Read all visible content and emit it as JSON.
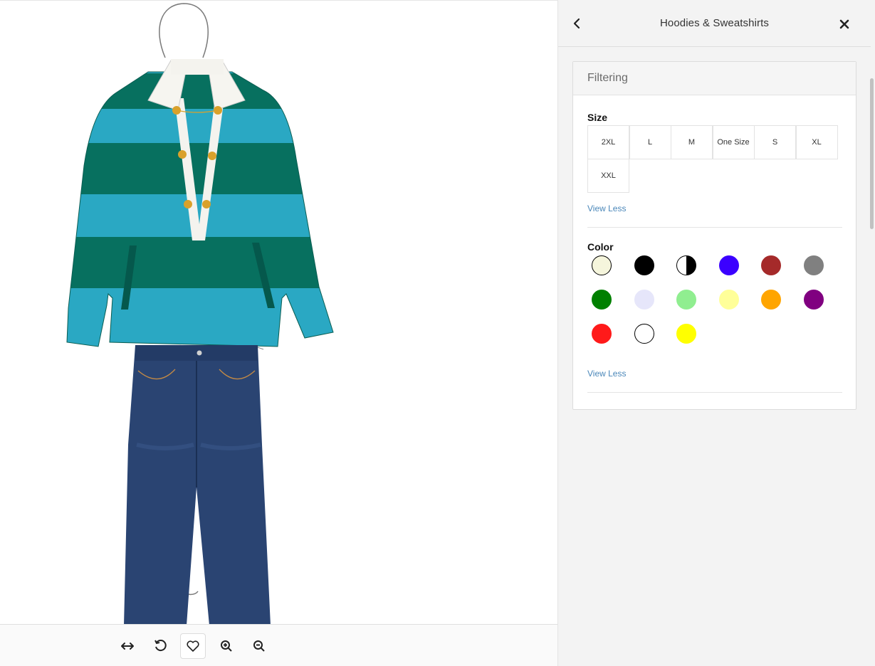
{
  "toolbar": {
    "items": [
      {
        "name": "fit-width-icon"
      },
      {
        "name": "undo-icon"
      },
      {
        "name": "heart-icon"
      },
      {
        "name": "zoom-in-icon"
      },
      {
        "name": "zoom-out-icon"
      }
    ]
  },
  "panel": {
    "title": "Hoodies & Sweatshirts",
    "filter_heading": "Filtering",
    "size": {
      "title": "Size",
      "options": [
        "2XL",
        "L",
        "M",
        "One Size",
        "S",
        "XL",
        "XXL"
      ],
      "view_less": "View Less"
    },
    "color": {
      "title": "Color",
      "swatches": [
        "#f5f5dc",
        "#000000",
        "black-white-half",
        "#3b00ff",
        "#a52a2a",
        "#808080",
        "#008000",
        "#e6e6fa",
        "#90ee90",
        "#ffff99",
        "#ffa500",
        "#800080",
        "#ff1a1a",
        "#ffffff",
        "#ffff00"
      ],
      "view_less": "View Less"
    }
  },
  "colors": {
    "sweater_light": "#2aa8c3",
    "sweater_dark": "#07705f",
    "denim": "#2a4472",
    "link": "#4a87b9"
  }
}
